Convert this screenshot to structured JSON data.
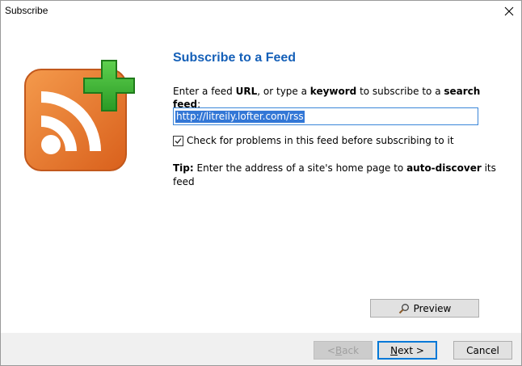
{
  "window": {
    "title": "Subscribe"
  },
  "heading": "Subscribe to a Feed",
  "instructions": {
    "p1": "Enter a feed ",
    "b1": "URL",
    "p2": ", or type a ",
    "b2": "keyword",
    "p3": " to subscribe to a ",
    "b3": "search feed",
    "p4": ":"
  },
  "url_input": {
    "value": "http://litreily.lofter.com/rss"
  },
  "check": {
    "label": "Check for problems in this feed before subscribing to it",
    "checked": true
  },
  "tip": {
    "label": "Tip:",
    "p1": " Enter the address of a site's home page to ",
    "b1": "auto-discover",
    "p2": " its feed"
  },
  "buttons": {
    "preview": "Preview",
    "back_accel": "B",
    "back_pre": "< ",
    "back_post": "ack",
    "next_accel": "N",
    "next_post": "ext >",
    "cancel": "Cancel"
  },
  "colors": {
    "accent": "#1560b8",
    "rss_orange": "#e8762b",
    "plus_green": "#3aa832"
  },
  "icons": [
    "rss-feed-logo-icon",
    "plus-icon",
    "close-icon",
    "magnifier-icon",
    "checkmark-icon"
  ]
}
